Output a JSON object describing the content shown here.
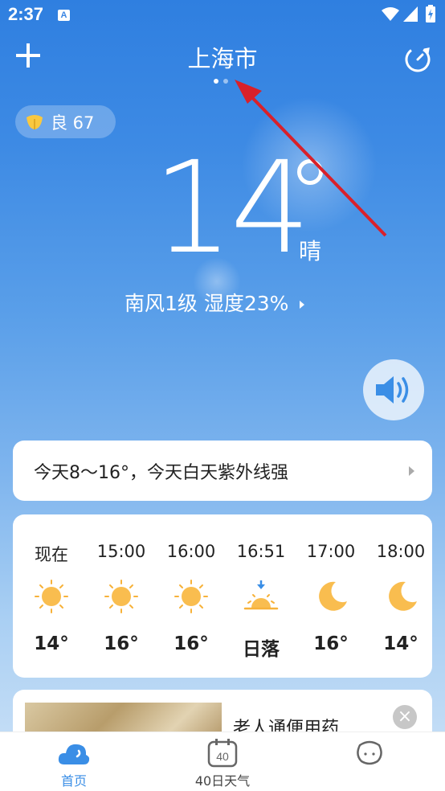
{
  "status_bar": {
    "time": "2:37",
    "notif_badge": "A"
  },
  "header": {
    "city": "上海市"
  },
  "aqi": {
    "label": "良 67"
  },
  "current": {
    "temperature": "14",
    "condition": "晴",
    "wind_humidity": "南风1级  湿度23%"
  },
  "summary": {
    "text": "今天8～16°，今天白天紫外线强"
  },
  "hourly": [
    {
      "time": "现在",
      "temp": "14°",
      "icon": "sun-icon"
    },
    {
      "time": "15:00",
      "temp": "16°",
      "icon": "sun-icon"
    },
    {
      "time": "16:00",
      "temp": "16°",
      "icon": "sun-icon"
    },
    {
      "time": "16:51",
      "temp": "日落",
      "icon": "sunset-icon"
    },
    {
      "time": "17:00",
      "temp": "16°",
      "icon": "moon-icon"
    },
    {
      "time": "18:00",
      "temp": "14°",
      "icon": "moon-icon"
    }
  ],
  "news": {
    "title": "老人通便用药"
  },
  "tabs": [
    {
      "label": "首页",
      "icon": "cloud-icon",
      "active": true
    },
    {
      "label": "40日天气",
      "icon": "calendar-40-icon",
      "active": false
    },
    {
      "label": "",
      "icon": "face-icon",
      "active": false
    }
  ],
  "colors": {
    "accent": "#3a8ee6",
    "sun": "#f7b23a",
    "arrow": "#d9202a"
  }
}
